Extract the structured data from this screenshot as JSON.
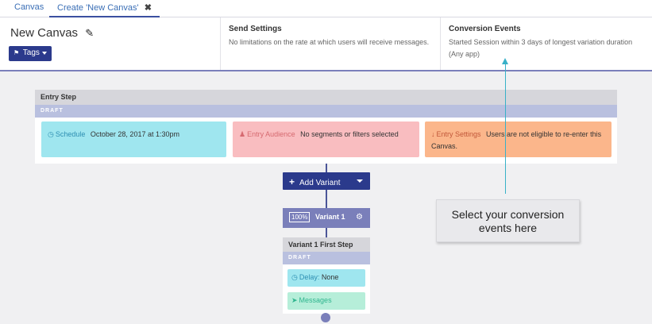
{
  "tabs": [
    {
      "label": "Canvas"
    },
    {
      "label": "Create 'New Canvas'",
      "close": "✖"
    }
  ],
  "header": {
    "canvas_name": "New Canvas",
    "tags_label": "Tags",
    "send_settings": {
      "title": "Send Settings",
      "description": "No limitations on the rate at which users will receive messages."
    },
    "conversion_events": {
      "title": "Conversion Events",
      "description": "Started Session within 3 days of longest variation duration (Any app)"
    }
  },
  "entry_step": {
    "title": "Entry Step",
    "status": "DRAFT",
    "schedule": {
      "label": "Schedule",
      "value": "October 28, 2017 at 1:30pm"
    },
    "audience": {
      "label": "Entry Audience",
      "value": "No segments or filters selected"
    },
    "settings": {
      "label": "Entry Settings",
      "value": "Users are not eligible to re-enter this Canvas."
    }
  },
  "add_variant_label": "Add Variant",
  "variant": {
    "percent": "100%",
    "name": "Variant 1"
  },
  "variant_step": {
    "title": "Variant 1 First Step",
    "status": "DRAFT",
    "delay": {
      "label": "Delay:",
      "value": "None"
    },
    "messages_label": "Messages"
  },
  "annotation": {
    "text": "Select your conversion events here"
  },
  "colors": {
    "primary": "#2b3a8c",
    "variant": "#7a7fba",
    "schedule": "#9fe6ef",
    "audience": "#f9bdc0",
    "entry_settings": "#fbb68b",
    "messages": "#b6eed9",
    "annotation_line": "#38b1c8"
  }
}
